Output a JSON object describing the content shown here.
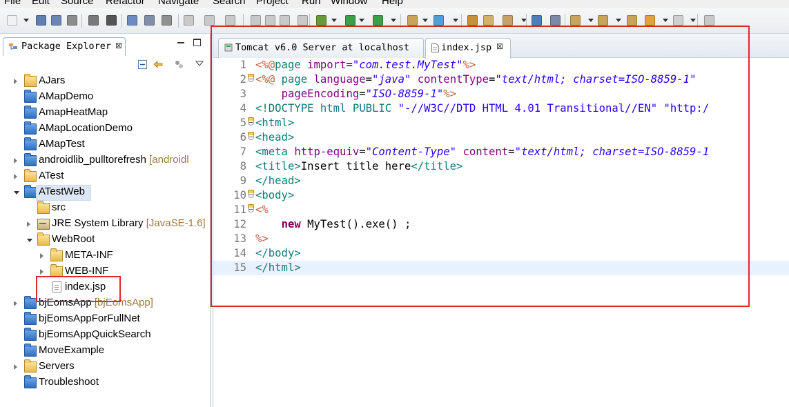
{
  "menu": [
    "File",
    "Edit",
    "Source",
    "Refactor",
    "Navigate",
    "Search",
    "Project",
    "Run",
    "Window",
    "Help"
  ],
  "package_explorer": {
    "title": "Package Explorer",
    "close_glyph": "⊠",
    "items": [
      {
        "label": "AJars",
        "decoration": "",
        "icon": "folder-icon",
        "twisty": "closed",
        "indent": 0
      },
      {
        "label": "AMapDemo",
        "decoration": "",
        "icon": "project-icon",
        "twisty": "none",
        "indent": 0
      },
      {
        "label": "AmapHeatMap",
        "decoration": "",
        "icon": "project-icon",
        "twisty": "none",
        "indent": 0
      },
      {
        "label": "AMapLocationDemo",
        "decoration": "",
        "icon": "project-icon",
        "twisty": "none",
        "indent": 0
      },
      {
        "label": "AMapTest",
        "decoration": "",
        "icon": "project-icon",
        "twisty": "none",
        "indent": 0
      },
      {
        "label": "androidlib_pulltorefresh",
        "decoration": "[androidl",
        "icon": "android-project-icon",
        "twisty": "closed",
        "indent": 0
      },
      {
        "label": "ATest",
        "decoration": "",
        "icon": "folder-icon",
        "twisty": "closed",
        "indent": 0
      },
      {
        "label": "ATestWeb",
        "decoration": "",
        "icon": "web-project-icon",
        "twisty": "open",
        "indent": 0,
        "selected": true
      },
      {
        "label": "src",
        "decoration": "",
        "icon": "source-folder-icon",
        "twisty": "none",
        "indent": 1
      },
      {
        "label": "JRE System Library",
        "decoration": "[JavaSE-1.6]",
        "icon": "library-icon",
        "twisty": "closed",
        "indent": 1
      },
      {
        "label": "WebRoot",
        "decoration": "",
        "icon": "folder-icon",
        "twisty": "open",
        "indent": 1
      },
      {
        "label": "META-INF",
        "decoration": "",
        "icon": "folder-icon",
        "twisty": "closed",
        "indent": 2
      },
      {
        "label": "WEB-INF",
        "decoration": "",
        "icon": "folder-icon",
        "twisty": "closed",
        "indent": 2
      },
      {
        "label": "index.jsp",
        "decoration": "",
        "icon": "file-icon",
        "twisty": "none",
        "indent": 2
      },
      {
        "label": "bjEomsApp",
        "decoration": "[bjEomsApp]",
        "icon": "android-project-icon",
        "twisty": "closed",
        "indent": 0
      },
      {
        "label": "bjEomsAppForFullNet",
        "decoration": "",
        "icon": "project-icon",
        "twisty": "none",
        "indent": 0
      },
      {
        "label": "bjEomsAppQuickSearch",
        "decoration": "",
        "icon": "project-icon",
        "twisty": "none",
        "indent": 0
      },
      {
        "label": "MoveExample",
        "decoration": "",
        "icon": "project-icon",
        "twisty": "none",
        "indent": 0
      },
      {
        "label": "Servers",
        "decoration": "",
        "icon": "folder-icon",
        "twisty": "closed",
        "indent": 0
      },
      {
        "label": "Troubleshoot",
        "decoration": "",
        "icon": "project-icon",
        "twisty": "none",
        "indent": 0
      }
    ]
  },
  "editor": {
    "tabs": [
      {
        "label": "Tomcat v6.0 Server at localhost",
        "active": false
      },
      {
        "label": "index.jsp",
        "active": true,
        "close_glyph": "⊠"
      }
    ],
    "lines": [
      {
        "n": "1",
        "fold": false,
        "html": "<span class=\"jsp\">&lt;%@</span><span class=\"tag\">page</span> <span class=\"attr\">import</span>=<span class=\"str\">\"com.test.MyTest\"</span><span class=\"jsp\">%&gt;</span>"
      },
      {
        "n": "2",
        "fold": true,
        "html": "<span class=\"jsp\">&lt;%@</span> <span class=\"tag\">page</span> <span class=\"attr\">language</span>=<span class=\"str\">\"java\"</span> <span class=\"attr\">contentType</span>=<span class=\"str\">\"text/html; charset=ISO-8859-1\"</span>"
      },
      {
        "n": "3",
        "fold": false,
        "html": "    <span class=\"attr\">pageEncoding</span>=<span class=\"str\">\"ISO-8859-1\"</span><span class=\"jsp\">%&gt;</span>"
      },
      {
        "n": "4",
        "fold": false,
        "html": "<span class=\"tag\">&lt;!DOCTYPE html</span> <span class=\"tag\">PUBLIC</span> <span class=\"dstr\">\"-//W3C//DTD HTML 4.01 Transitional//EN\"</span> <span class=\"dstr\">\"http:/</span>"
      },
      {
        "n": "5",
        "fold": true,
        "html": "<span class=\"tag\">&lt;html&gt;</span>"
      },
      {
        "n": "6",
        "fold": true,
        "html": "<span class=\"tag\">&lt;head&gt;</span>"
      },
      {
        "n": "7",
        "fold": false,
        "html": "<span class=\"tag\">&lt;meta</span> <span class=\"attr\">http-equiv</span>=<span class=\"str\">\"Content-Type\"</span> <span class=\"attr\">content</span>=<span class=\"str\">\"text/html; charset=ISO-8859-1</span>"
      },
      {
        "n": "8",
        "fold": false,
        "html": "<span class=\"tag\">&lt;title&gt;</span>Insert title here<span class=\"tag\">&lt;/title&gt;</span>"
      },
      {
        "n": "9",
        "fold": false,
        "html": "<span class=\"tag\">&lt;/head&gt;</span>"
      },
      {
        "n": "10",
        "fold": true,
        "html": "<span class=\"tag\">&lt;body&gt;</span>"
      },
      {
        "n": "11",
        "fold": true,
        "html": "<span class=\"jsp\">&lt;%</span>"
      },
      {
        "n": "12",
        "fold": false,
        "html": "    <span class=\"kw\">new</span> MyTest().exe() ;"
      },
      {
        "n": "13",
        "fold": false,
        "html": "<span class=\"jsp\">%&gt;</span>"
      },
      {
        "n": "14",
        "fold": false,
        "html": "<span class=\"tag\">&lt;/body&gt;</span>"
      },
      {
        "n": "15",
        "fold": false,
        "html": "<span class=\"tag\">&lt;/html&gt;</span>",
        "current": true
      }
    ]
  },
  "colors": {
    "highlight_box": "#e0262a",
    "selection": "#dde7f3",
    "current_line": "#e8f2fe"
  }
}
